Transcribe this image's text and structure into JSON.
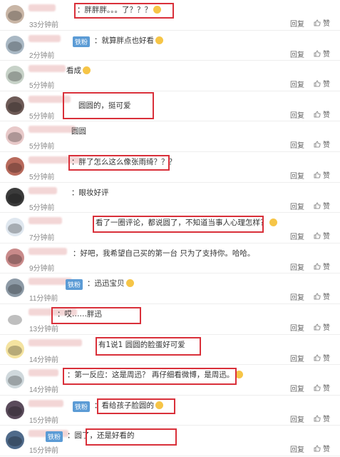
{
  "ui": {
    "reply_label": "回复",
    "like_label": "赞",
    "badge_label": "铁粉",
    "vip_mark": "V",
    "like_icon": "thumbs-up-icon"
  },
  "comments": [
    {
      "text": "：胖胖胖。。。了？？？",
      "emoji": true,
      "time": "33分钟前",
      "badge": false,
      "highlight": true
    },
    {
      "text": "：就算胖点也好看",
      "emoji": true,
      "time": "2分钟前",
      "badge": true,
      "highlight": false
    },
    {
      "text": "看成",
      "emoji": true,
      "time": "5分钟前",
      "badge": false,
      "highlight": false
    },
    {
      "text": "圆圆的，挺可爱",
      "emoji": false,
      "time": "5分钟前",
      "badge": false,
      "highlight": true
    },
    {
      "text": "圆圆",
      "emoji": false,
      "time": "5分钟前",
      "badge": false,
      "highlight": false
    },
    {
      "text": "：胖了怎么这么像张雨绮？？？",
      "emoji": false,
      "time": "5分钟前",
      "badge": false,
      "highlight": true
    },
    {
      "text": "：眼妆好评",
      "emoji": false,
      "time": "5分钟前",
      "badge": false,
      "highlight": false
    },
    {
      "text": "看了一圈评论，都说圆了，不知道当事人心理怎样？",
      "emoji": true,
      "time": "7分钟前",
      "badge": false,
      "highlight": true
    },
    {
      "text": "：好吧，我希望自己买的第一台 只为了支持你。哈哈。",
      "emoji": false,
      "time": "9分钟前",
      "badge": false,
      "highlight": false
    },
    {
      "text": "：迅迅宝贝",
      "emoji": true,
      "time": "11分钟前",
      "badge": true,
      "highlight": false
    },
    {
      "text": "：哎……胖迅",
      "emoji": false,
      "time": "13分钟前",
      "badge": false,
      "highlight": true
    },
    {
      "text": "有1说1 圆圆的脸蛋好可爱",
      "emoji": false,
      "time": "14分钟前",
      "badge": false,
      "highlight": true
    },
    {
      "text": "：第一反应：这是周迅？ 再仔细看微博，是周迅。",
      "emoji": true,
      "time": "14分钟前",
      "badge": false,
      "highlight": true
    },
    {
      "text": "：看给孩子脸圆的",
      "emoji": true,
      "time": "15分钟前",
      "badge": true,
      "highlight": true
    },
    {
      "text": "：圆了，还是好看的",
      "emoji": false,
      "time": "15分钟前",
      "badge": true,
      "highlight": true
    }
  ]
}
